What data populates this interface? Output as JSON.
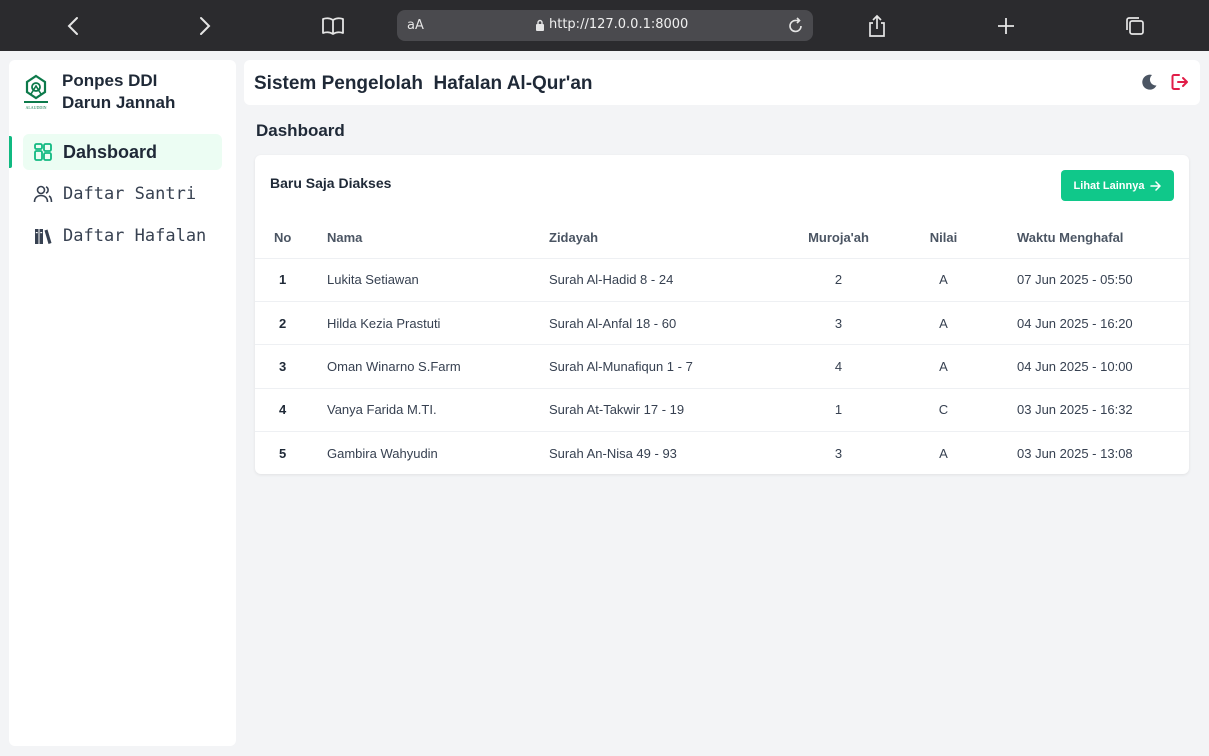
{
  "browser": {
    "address_hint": "aA",
    "url": "http://127.0.0.1:8000"
  },
  "sidebar": {
    "brand_line1": "Ponpes DDI",
    "brand_line2": "Darun Jannah",
    "logo_caption": "ALAUDDIN",
    "items": [
      {
        "label": "Dahsboard",
        "icon": "dashboard-grid-icon",
        "active": true
      },
      {
        "label": "Daftar Santri",
        "icon": "users-icon",
        "active": false
      },
      {
        "label": "Daftar Hafalan",
        "icon": "books-icon",
        "active": false
      }
    ]
  },
  "header": {
    "title": "Sistem Pengelolah  Hafalan Al-Qur'an",
    "theme_icon": "moon-icon",
    "logout_icon": "logout-icon"
  },
  "page": {
    "title": "Dashboard"
  },
  "recent": {
    "title": "Baru Saja Diakses",
    "more_label": "Lihat Lainnya",
    "columns": [
      "No",
      "Nama",
      "Zidayah",
      "Muroja'ah",
      "Nilai",
      "Waktu Menghafal"
    ],
    "rows": [
      {
        "no": "1",
        "nama": "Lukita Setiawan",
        "zidayah": "Surah Al-Hadid 8 - 24",
        "murojaah": "2",
        "nilai": "A",
        "waktu": "07 Jun 2025 - 05:50"
      },
      {
        "no": "2",
        "nama": "Hilda Kezia Prastuti",
        "zidayah": "Surah Al-Anfal 18 - 60",
        "murojaah": "3",
        "nilai": "A",
        "waktu": "04 Jun 2025 - 16:20"
      },
      {
        "no": "3",
        "nama": "Oman Winarno S.Farm",
        "zidayah": "Surah Al-Munafiqun 1 - 7",
        "murojaah": "4",
        "nilai": "A",
        "waktu": "04 Jun 2025 - 10:00"
      },
      {
        "no": "4",
        "nama": "Vanya Farida M.TI.",
        "zidayah": "Surah At-Takwir 17 - 19",
        "murojaah": "1",
        "nilai": "C",
        "waktu": "03 Jun 2025 - 16:32"
      },
      {
        "no": "5",
        "nama": "Gambira Wahyudin",
        "zidayah": "Surah An-Nisa 49 - 93",
        "murojaah": "3",
        "nilai": "A",
        "waktu": "03 Jun 2025 - 13:08"
      }
    ]
  },
  "colors": {
    "accent": "#10c88a",
    "logout": "#e11d48",
    "active_bg": "#ecfdf3"
  }
}
